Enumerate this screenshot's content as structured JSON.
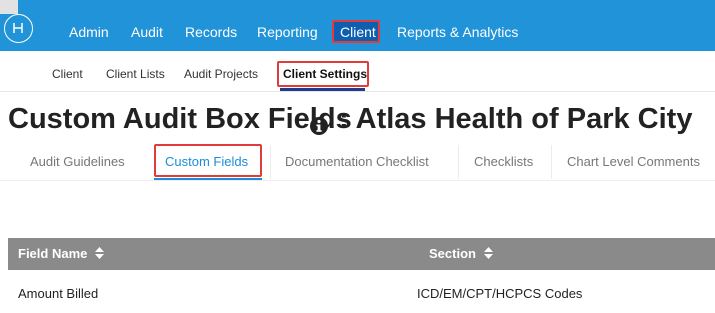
{
  "colors": {
    "nav_bg": "#2193d8",
    "active_nav_bg": "#0f5fb0",
    "highlight_border": "#e23b3b",
    "active_tab": "#1a8fd6",
    "table_header_bg": "#8a8a8a"
  },
  "nav": {
    "logo_icon": "h-circle-logo-icon",
    "items": [
      "Admin",
      "Audit",
      "Records",
      "Reporting",
      "Client",
      "Reports & Analytics"
    ]
  },
  "subnav": {
    "items": [
      "Client",
      "Client Lists",
      "Audit Projects",
      "Client Settings"
    ]
  },
  "page": {
    "title": "Custom Audit Box Fields",
    "info_icon": "info-circle-icon",
    "subtitle": ": Atlas Health of Park City"
  },
  "tabs": [
    "Audit Guidelines",
    "Custom Fields",
    "Documentation Checklist",
    "Checklists",
    "Chart Level Comments"
  ],
  "table": {
    "columns": [
      "Field Name",
      "Section"
    ],
    "sort_icon": "sort-icon",
    "rows": [
      {
        "field_name": "Amount Billed",
        "section": "ICD/EM/CPT/HCPCS Codes"
      }
    ]
  }
}
